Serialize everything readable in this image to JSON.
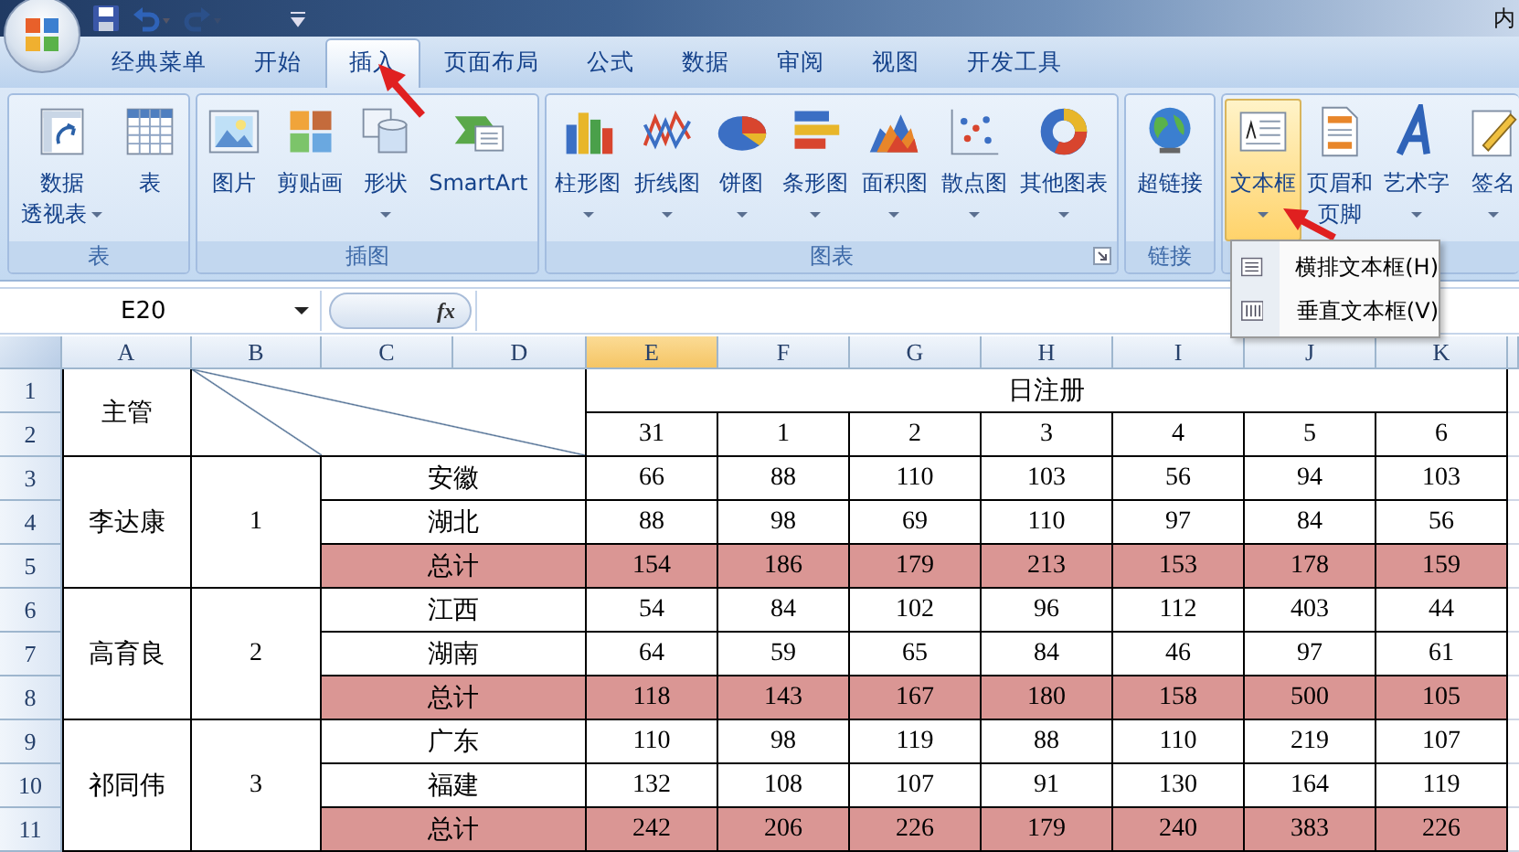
{
  "window": {
    "title": "内"
  },
  "quick_access": [
    {
      "kind": "save",
      "disabled": false
    },
    {
      "kind": "undo",
      "disabled": false
    },
    {
      "kind": "redo",
      "disabled": true
    },
    {
      "kind": "customize",
      "disabled": false
    }
  ],
  "tabs": [
    {
      "label": "经典菜单",
      "selected": false
    },
    {
      "label": "开始",
      "selected": false
    },
    {
      "label": "插入",
      "selected": true
    },
    {
      "label": "页面布局",
      "selected": false
    },
    {
      "label": "公式",
      "selected": false
    },
    {
      "label": "数据",
      "selected": false
    },
    {
      "label": "审阅",
      "selected": false
    },
    {
      "label": "视图",
      "selected": false
    },
    {
      "label": "开发工具",
      "selected": false
    }
  ],
  "ribbon": {
    "groups": [
      {
        "label": "表",
        "launcher": false,
        "buttons": [
          {
            "lines": [
              "数据",
              "透视表"
            ],
            "dropdown": true,
            "pressed": false
          },
          {
            "lines": [
              "表"
            ],
            "dropdown": false,
            "pressed": false
          }
        ]
      },
      {
        "label": "插图",
        "launcher": false,
        "buttons": [
          {
            "lines": [
              "图片"
            ],
            "dropdown": false,
            "pressed": false
          },
          {
            "lines": [
              "剪贴画"
            ],
            "dropdown": false,
            "pressed": false
          },
          {
            "lines": [
              "形状"
            ],
            "dropdown": true,
            "pressed": false
          },
          {
            "lines": [
              "SmartArt"
            ],
            "dropdown": false,
            "pressed": false
          }
        ]
      },
      {
        "label": "图表",
        "launcher": true,
        "buttons": [
          {
            "lines": [
              "柱形图"
            ],
            "dropdown": true,
            "pressed": false
          },
          {
            "lines": [
              "折线图"
            ],
            "dropdown": true,
            "pressed": false
          },
          {
            "lines": [
              "饼图"
            ],
            "dropdown": true,
            "pressed": false
          },
          {
            "lines": [
              "条形图"
            ],
            "dropdown": true,
            "pressed": false
          },
          {
            "lines": [
              "面积图"
            ],
            "dropdown": true,
            "pressed": false
          },
          {
            "lines": [
              "散点图"
            ],
            "dropdown": true,
            "pressed": false
          },
          {
            "lines": [
              "其他图表"
            ],
            "dropdown": true,
            "pressed": false
          }
        ]
      },
      {
        "label": "链接",
        "launcher": false,
        "buttons": [
          {
            "lines": [
              "超链接"
            ],
            "dropdown": false,
            "pressed": false
          }
        ]
      },
      {
        "buttons": [
          {
            "lines": [
              "文本框"
            ],
            "dropdown": true,
            "pressed": true
          },
          {
            "lines": [
              "页眉和",
              "页脚"
            ],
            "dropdown": false,
            "pressed": false
          },
          {
            "lines": [
              "艺术字"
            ],
            "dropdown": true,
            "pressed": false
          },
          {
            "lines": [
              "签名"
            ],
            "dropdown": true,
            "pressed": false
          }
        ]
      }
    ]
  },
  "text_box_menu": {
    "items": [
      {
        "label": "横排文本框(H)"
      },
      {
        "label": "垂直文本框(V)"
      }
    ]
  },
  "formula_bar": {
    "name_box": "E20",
    "function_label": "fx"
  },
  "sheet": {
    "columns": [
      {
        "label": "A",
        "selected": false
      },
      {
        "label": "B",
        "selected": false
      },
      {
        "label": "C",
        "selected": false
      },
      {
        "label": "D",
        "selected": false
      },
      {
        "label": "E",
        "selected": true
      },
      {
        "label": "F",
        "selected": false
      },
      {
        "label": "G",
        "selected": false
      },
      {
        "label": "H",
        "selected": false
      },
      {
        "label": "I",
        "selected": false
      },
      {
        "label": "J",
        "selected": false
      },
      {
        "label": "K",
        "selected": false
      }
    ],
    "rows": [
      "1",
      "2",
      "3",
      "4",
      "5",
      "6",
      "7",
      "8",
      "9",
      "10",
      "11"
    ],
    "header": {
      "manager": "主管",
      "title": "日注册",
      "days": [
        "31",
        "1",
        "2",
        "3",
        "4",
        "5",
        "6"
      ]
    },
    "groups": [
      {
        "manager": "李达康",
        "number": "1",
        "rows": [
          {
            "region": "安徽",
            "kind": "detail",
            "values": [
              "66",
              "88",
              "110",
              "103",
              "56",
              "94",
              "103"
            ]
          },
          {
            "region": "湖北",
            "kind": "detail",
            "values": [
              "88",
              "98",
              "69",
              "110",
              "97",
              "84",
              "56"
            ]
          },
          {
            "region": "总计",
            "kind": "total",
            "values": [
              "154",
              "186",
              "179",
              "213",
              "153",
              "178",
              "159"
            ]
          }
        ]
      },
      {
        "manager": "高育良",
        "number": "2",
        "rows": [
          {
            "region": "江西",
            "kind": "detail",
            "values": [
              "54",
              "84",
              "102",
              "96",
              "112",
              "403",
              "44"
            ]
          },
          {
            "region": "湖南",
            "kind": "detail",
            "values": [
              "64",
              "59",
              "65",
              "84",
              "46",
              "97",
              "61"
            ]
          },
          {
            "region": "总计",
            "kind": "total",
            "values": [
              "118",
              "143",
              "167",
              "180",
              "158",
              "500",
              "105"
            ]
          }
        ]
      },
      {
        "manager": "祁同伟",
        "number": "3",
        "rows": [
          {
            "region": "广东",
            "kind": "detail",
            "values": [
              "110",
              "98",
              "119",
              "88",
              "110",
              "219",
              "107"
            ]
          },
          {
            "region": "福建",
            "kind": "detail",
            "values": [
              "132",
              "108",
              "107",
              "91",
              "130",
              "164",
              "119"
            ]
          },
          {
            "region": "总计",
            "kind": "total",
            "values": [
              "242",
              "206",
              "226",
              "179",
              "240",
              "383",
              "226"
            ]
          }
        ]
      }
    ]
  }
}
